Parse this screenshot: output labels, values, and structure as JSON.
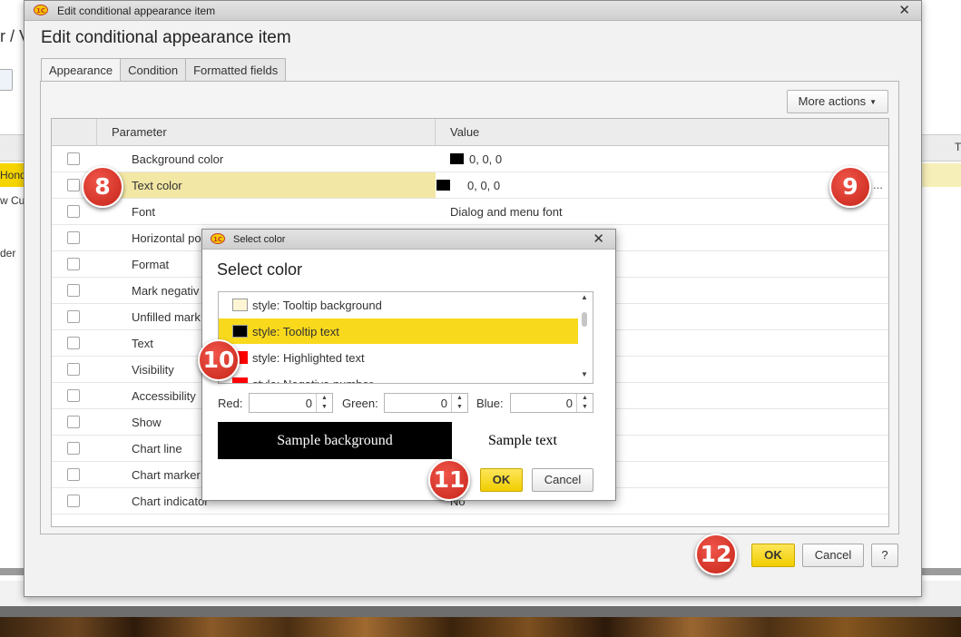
{
  "background": {
    "breadcrumb_fragment": "r / V",
    "row_selected": "Hond",
    "row_2": "w Cu",
    "row_3": "der",
    "right_col_header": "T"
  },
  "main_dialog": {
    "window_title": "Edit conditional appearance item",
    "heading": "Edit conditional appearance item",
    "tabs": [
      "Appearance",
      "Condition",
      "Formatted fields"
    ],
    "active_tab": "Appearance",
    "more_actions_label": "More actions",
    "grid": {
      "col_parameter": "Parameter",
      "col_value": "Value",
      "rows": [
        {
          "name": "Background color",
          "value": "0, 0, 0",
          "swatch": "#000000",
          "checked": false
        },
        {
          "name": "Text color",
          "value": "0, 0, 0",
          "swatch": "#000000",
          "checked": false,
          "selected": true,
          "extra": "..."
        },
        {
          "name": "Font",
          "value": "Dialog and menu font",
          "checked": false
        },
        {
          "name": "Horizontal po",
          "value": "",
          "checked": false
        },
        {
          "name": "Format",
          "value": "",
          "checked": false
        },
        {
          "name": "Mark negativ",
          "value": "",
          "checked": false
        },
        {
          "name": "Unfilled mark",
          "value": "",
          "checked": false
        },
        {
          "name": "Text",
          "value": "",
          "checked": false
        },
        {
          "name": "Visibility",
          "value": "",
          "checked": false
        },
        {
          "name": "Accessibility",
          "value": "",
          "checked": false
        },
        {
          "name": "Show",
          "value": "",
          "checked": false
        },
        {
          "name": "Chart line",
          "value": "",
          "checked": false
        },
        {
          "name": "Chart marker",
          "value": "",
          "checked": false
        },
        {
          "name": "Chart indicator",
          "value": "No",
          "checked": false
        }
      ]
    },
    "ok_label": "OK",
    "cancel_label": "Cancel",
    "help_label": "?"
  },
  "select_color_dialog": {
    "window_title": "Select color",
    "heading": "Select color",
    "items": [
      {
        "label": "style: Tooltip background",
        "color": "#fdf5d4"
      },
      {
        "label": "style: Tooltip text",
        "color": "#000000",
        "selected": true
      },
      {
        "label": "style: Highlighted text",
        "color": "#ff0000"
      },
      {
        "label": "style: Negative number",
        "color": "#ff0000"
      }
    ],
    "red_label": "Red:",
    "red_value": "0",
    "green_label": "Green:",
    "green_value": "0",
    "blue_label": "Blue:",
    "blue_value": "0",
    "sample_background": "Sample background",
    "sample_text": "Sample text",
    "ok_label": "OK",
    "cancel_label": "Cancel"
  },
  "callouts": [
    "8",
    "9",
    "10",
    "11",
    "12"
  ],
  "colors": {
    "accent_yellow": "#f6d400",
    "selection_row": "#f2e7a4",
    "callout_red": "#d9352a"
  }
}
